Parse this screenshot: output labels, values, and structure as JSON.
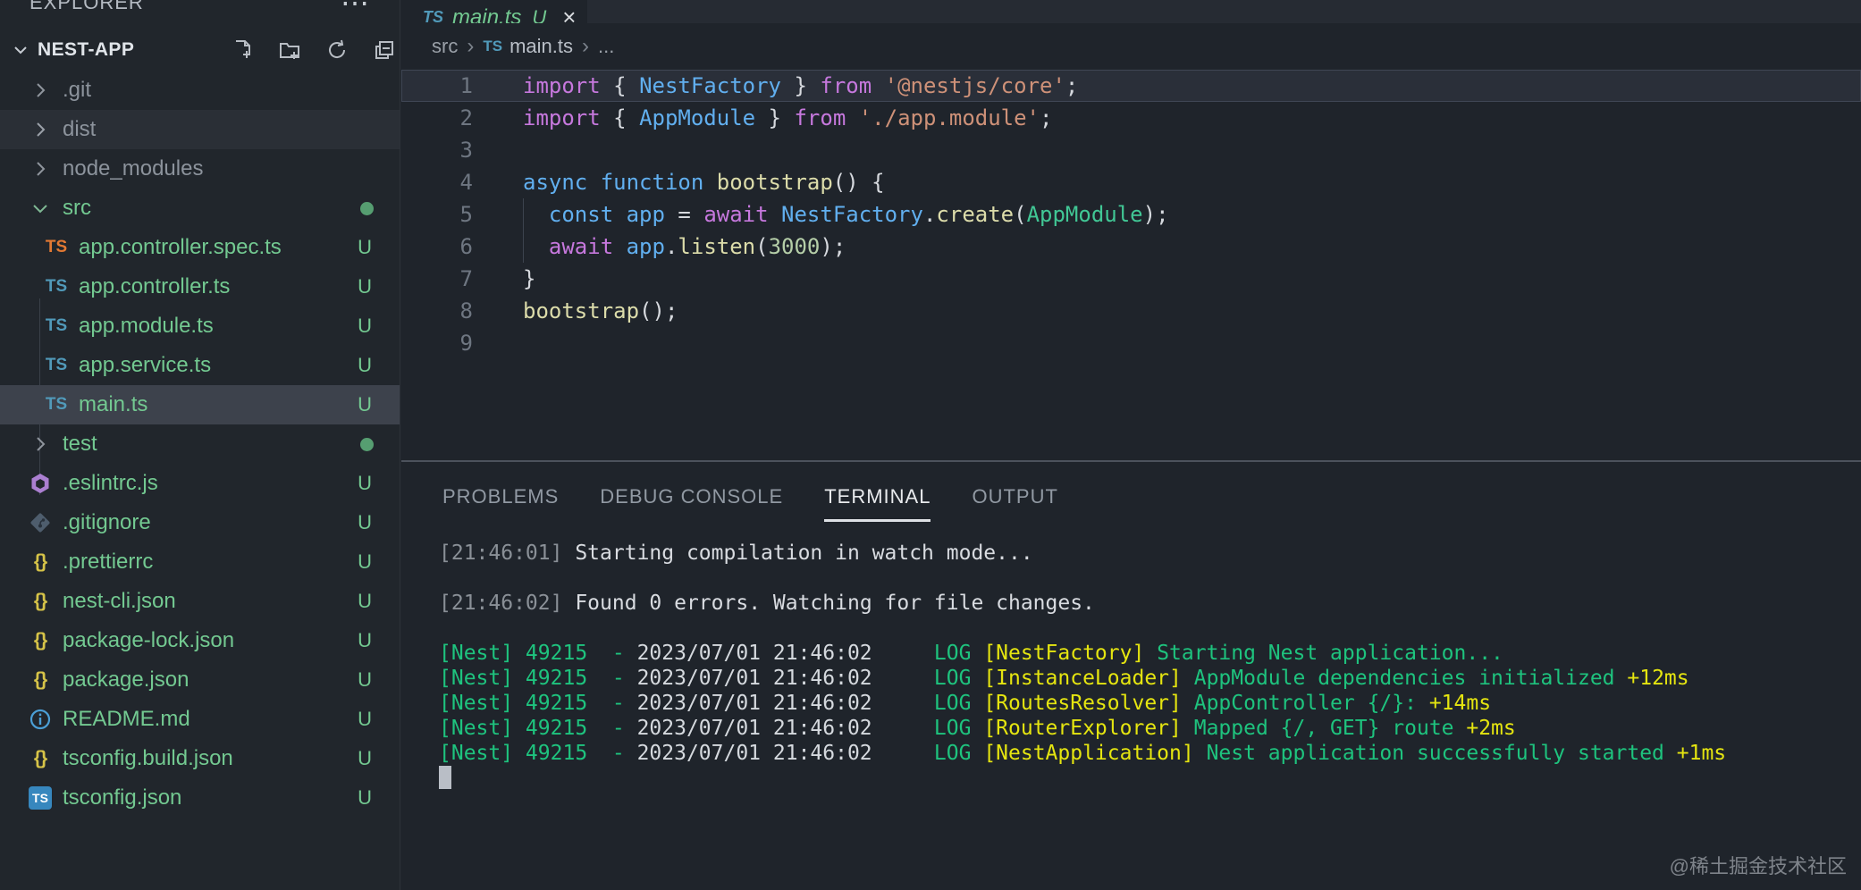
{
  "icons": {
    "ts": "TS",
    "braces": "{}",
    "more": "⋯",
    "close": "×",
    "info_i": "i"
  },
  "explorer": {
    "title": "EXPLORER",
    "project": "NEST-APP",
    "items": [
      {
        "name": ".git",
        "type": "folder",
        "state": "collapsed",
        "color": "ignored"
      },
      {
        "name": "dist",
        "type": "folder",
        "state": "collapsed",
        "color": "ignored",
        "hovered": true
      },
      {
        "name": "node_modules",
        "type": "folder",
        "state": "collapsed",
        "color": "ignored"
      },
      {
        "name": "src",
        "type": "folder",
        "state": "expanded",
        "color": "untracked",
        "badge": "dot"
      },
      {
        "name": "app.controller.spec.ts",
        "type": "file",
        "icon": "ts-orange",
        "badge": "U"
      },
      {
        "name": "app.controller.ts",
        "type": "file",
        "icon": "ts-blue",
        "badge": "U"
      },
      {
        "name": "app.module.ts",
        "type": "file",
        "icon": "ts-blue",
        "badge": "U"
      },
      {
        "name": "app.service.ts",
        "type": "file",
        "icon": "ts-blue",
        "badge": "U"
      },
      {
        "name": "main.ts",
        "type": "file",
        "icon": "ts-blue",
        "badge": "U",
        "selected": true
      },
      {
        "name": "test",
        "type": "folder",
        "state": "collapsed",
        "color": "untracked",
        "badge": "dot"
      },
      {
        "name": ".eslintrc.js",
        "type": "file",
        "icon": "eslint",
        "badge": "U"
      },
      {
        "name": ".gitignore",
        "type": "file",
        "icon": "git",
        "badge": "U"
      },
      {
        "name": ".prettierrc",
        "type": "file",
        "icon": "json",
        "badge": "U"
      },
      {
        "name": "nest-cli.json",
        "type": "file",
        "icon": "json",
        "badge": "U"
      },
      {
        "name": "package-lock.json",
        "type": "file",
        "icon": "json",
        "badge": "U"
      },
      {
        "name": "package.json",
        "type": "file",
        "icon": "json",
        "badge": "U"
      },
      {
        "name": "README.md",
        "type": "file",
        "icon": "info",
        "badge": "U"
      },
      {
        "name": "tsconfig.build.json",
        "type": "file",
        "icon": "json",
        "badge": "U"
      },
      {
        "name": "tsconfig.json",
        "type": "file",
        "icon": "ts-badge",
        "badge": "U"
      }
    ]
  },
  "tab": {
    "file": "main.ts",
    "dirty": "U",
    "lang": "TS"
  },
  "breadcrumb": {
    "folder": "src",
    "file": "main.ts",
    "ellipsis": "...",
    "sep": "›"
  },
  "editor": {
    "lines": [
      {
        "num": "1",
        "segments": [
          {
            "t": "import ",
            "c": "#C678DD"
          },
          {
            "t": "{ ",
            "c": "#D6D9DE"
          },
          {
            "t": "NestFactory",
            "c": "#61AFEF"
          },
          {
            "t": " } ",
            "c": "#D6D9DE"
          },
          {
            "t": "from ",
            "c": "#C678DD"
          },
          {
            "t": "'@nestjs/core'",
            "c": "#CE9178"
          },
          {
            "t": ";",
            "c": "#D6D9DE"
          }
        ]
      },
      {
        "num": "2",
        "segments": [
          {
            "t": "import ",
            "c": "#C678DD"
          },
          {
            "t": "{ ",
            "c": "#D6D9DE"
          },
          {
            "t": "AppModule",
            "c": "#61AFEF"
          },
          {
            "t": " } ",
            "c": "#D6D9DE"
          },
          {
            "t": "from ",
            "c": "#C678DD"
          },
          {
            "t": "'./app.module'",
            "c": "#CE9178"
          },
          {
            "t": ";",
            "c": "#D6D9DE"
          }
        ]
      },
      {
        "num": "3",
        "segments": []
      },
      {
        "num": "4",
        "segments": [
          {
            "t": "async ",
            "c": "#61AFEF"
          },
          {
            "t": "function ",
            "c": "#61AFEF"
          },
          {
            "t": "bootstrap",
            "c": "#DCDCAA"
          },
          {
            "t": "() {",
            "c": "#D6D9DE"
          }
        ]
      },
      {
        "num": "5",
        "segments": [
          {
            "t": "  ",
            "c": "#D6D9DE"
          },
          {
            "t": "const ",
            "c": "#61AFEF"
          },
          {
            "t": "app ",
            "c": "#61AFEF"
          },
          {
            "t": "= ",
            "c": "#D6D9DE"
          },
          {
            "t": "await ",
            "c": "#C678DD"
          },
          {
            "t": "NestFactory",
            "c": "#61AFEF"
          },
          {
            "t": ".",
            "c": "#D6D9DE"
          },
          {
            "t": "create",
            "c": "#DCDCAA"
          },
          {
            "t": "(",
            "c": "#D6D9DE"
          },
          {
            "t": "AppModule",
            "c": "#41C795"
          },
          {
            "t": ");",
            "c": "#D6D9DE"
          }
        ]
      },
      {
        "num": "6",
        "segments": [
          {
            "t": "  ",
            "c": "#D6D9DE"
          },
          {
            "t": "await ",
            "c": "#C678DD"
          },
          {
            "t": "app",
            "c": "#61AFEF"
          },
          {
            "t": ".",
            "c": "#D6D9DE"
          },
          {
            "t": "listen",
            "c": "#DCDCAA"
          },
          {
            "t": "(",
            "c": "#D6D9DE"
          },
          {
            "t": "3000",
            "c": "#B5CEA8"
          },
          {
            "t": ");",
            "c": "#D6D9DE"
          }
        ]
      },
      {
        "num": "7",
        "segments": [
          {
            "t": "}",
            "c": "#D6D9DE"
          }
        ]
      },
      {
        "num": "8",
        "segments": [
          {
            "t": "bootstrap",
            "c": "#DCDCAA"
          },
          {
            "t": "();",
            "c": "#D6D9DE"
          }
        ]
      },
      {
        "num": "9",
        "segments": []
      }
    ]
  },
  "panel": {
    "tabs": [
      {
        "label": "PROBLEMS",
        "active": false
      },
      {
        "label": "DEBUG CONSOLE",
        "active": false
      },
      {
        "label": "TERMINAL",
        "active": true
      },
      {
        "label": "OUTPUT",
        "active": false
      }
    ],
    "terminal": {
      "lines": [
        [
          {
            "t": "[21:46:01] ",
            "c": "#8A9097"
          },
          {
            "t": "Starting compilation in watch mode...",
            "c": "#D9DCE1"
          }
        ],
        [],
        [
          {
            "t": "[21:46:02] ",
            "c": "#8A9097"
          },
          {
            "t": "Found 0 errors. Watching for file changes.",
            "c": "#D9DCE1"
          }
        ],
        [],
        [
          {
            "t": "[Nest] 49215  - ",
            "c": "#1EC37E"
          },
          {
            "t": "2023/07/01 21:46:02",
            "c": "#D5D9DE"
          },
          {
            "t": "     ",
            "c": "#D5D9DE"
          },
          {
            "t": "LOG ",
            "c": "#1EC37E"
          },
          {
            "t": "[NestFactory] ",
            "c": "#E5E510"
          },
          {
            "t": "Starting Nest application...",
            "c": "#1EC37E"
          }
        ],
        [
          {
            "t": "[Nest] 49215  - ",
            "c": "#1EC37E"
          },
          {
            "t": "2023/07/01 21:46:02",
            "c": "#D5D9DE"
          },
          {
            "t": "     ",
            "c": "#D5D9DE"
          },
          {
            "t": "LOG ",
            "c": "#1EC37E"
          },
          {
            "t": "[InstanceLoader] ",
            "c": "#E5E510"
          },
          {
            "t": "AppModule dependencies initialized ",
            "c": "#1EC37E"
          },
          {
            "t": "+12ms",
            "c": "#E5E510"
          }
        ],
        [
          {
            "t": "[Nest] 49215  - ",
            "c": "#1EC37E"
          },
          {
            "t": "2023/07/01 21:46:02",
            "c": "#D5D9DE"
          },
          {
            "t": "     ",
            "c": "#D5D9DE"
          },
          {
            "t": "LOG ",
            "c": "#1EC37E"
          },
          {
            "t": "[RoutesResolver] ",
            "c": "#E5E510"
          },
          {
            "t": "AppController {/}: ",
            "c": "#1EC37E"
          },
          {
            "t": "+14ms",
            "c": "#E5E510"
          }
        ],
        [
          {
            "t": "[Nest] 49215  - ",
            "c": "#1EC37E"
          },
          {
            "t": "2023/07/01 21:46:02",
            "c": "#D5D9DE"
          },
          {
            "t": "     ",
            "c": "#D5D9DE"
          },
          {
            "t": "LOG ",
            "c": "#1EC37E"
          },
          {
            "t": "[RouterExplorer] ",
            "c": "#E5E510"
          },
          {
            "t": "Mapped {/, GET} route ",
            "c": "#1EC37E"
          },
          {
            "t": "+2ms",
            "c": "#E5E510"
          }
        ],
        [
          {
            "t": "[Nest] 49215  - ",
            "c": "#1EC37E"
          },
          {
            "t": "2023/07/01 21:46:02",
            "c": "#D5D9DE"
          },
          {
            "t": "     ",
            "c": "#D5D9DE"
          },
          {
            "t": "LOG ",
            "c": "#1EC37E"
          },
          {
            "t": "[NestApplication] ",
            "c": "#E5E510"
          },
          {
            "t": "Nest application successfully started ",
            "c": "#1EC37E"
          },
          {
            "t": "+1ms",
            "c": "#E5E510"
          }
        ]
      ]
    }
  },
  "watermark": "@稀土掘金技术社区"
}
